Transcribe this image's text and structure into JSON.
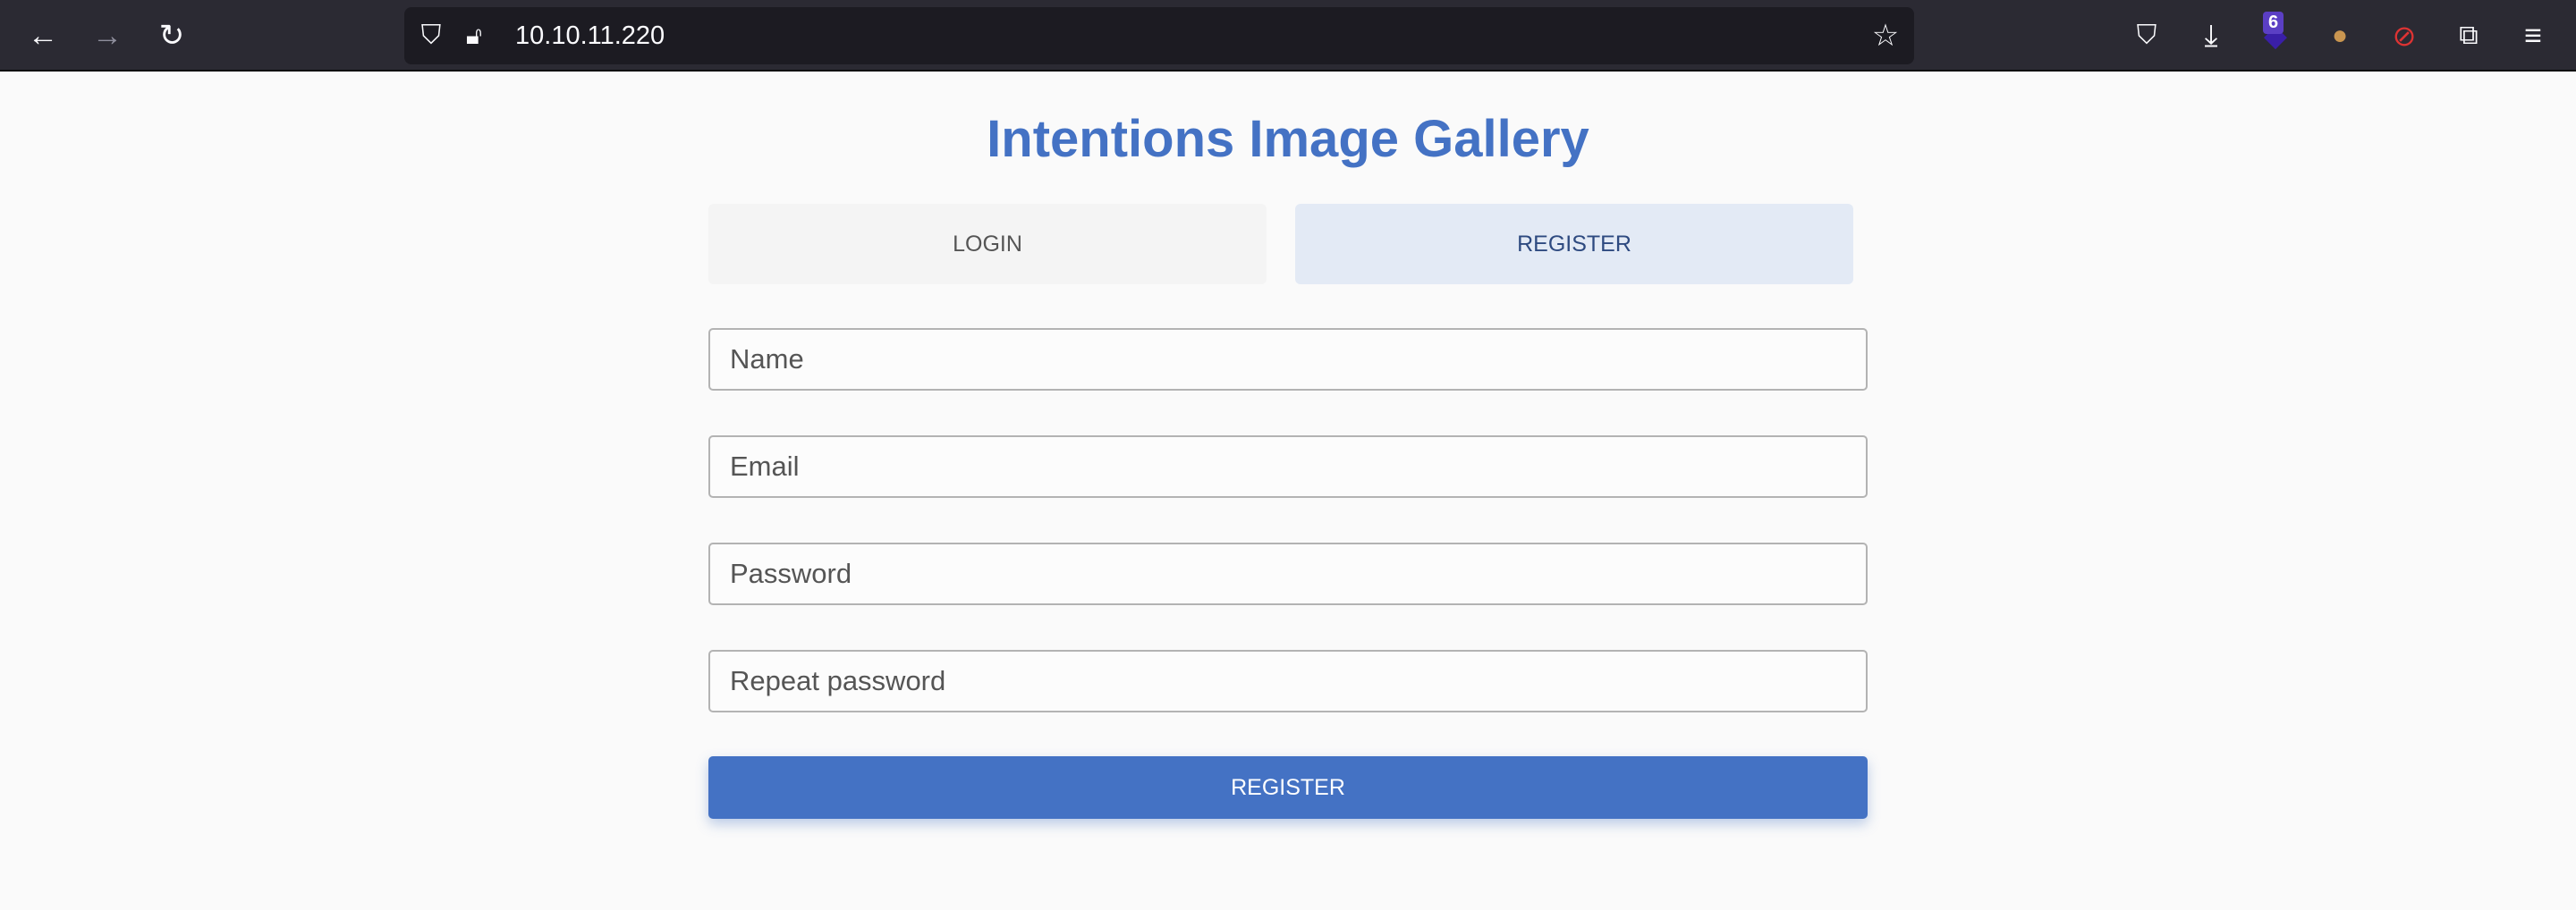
{
  "browser": {
    "url": "10.10.11.220",
    "extension_badge": "6",
    "icons": [
      "back-icon",
      "forward-icon",
      "reload-icon",
      "shield-icon",
      "insecure-lock-icon",
      "bookmark-star-icon",
      "pocket-icon",
      "download-icon",
      "extension-stack-icon",
      "cookie-icon",
      "blocked-extension-icon",
      "extensions-puzzle-icon",
      "menu-icon"
    ]
  },
  "page": {
    "title": "Intentions Image Gallery",
    "tabs": [
      {
        "label": "LOGIN",
        "active": false
      },
      {
        "label": "REGISTER",
        "active": true
      }
    ],
    "form": {
      "name_placeholder": "Name",
      "email_placeholder": "Email",
      "password_placeholder": "Password",
      "repeat_password_placeholder": "Repeat password",
      "submit_label": "REGISTER"
    },
    "accent_color": "#4472c4"
  }
}
